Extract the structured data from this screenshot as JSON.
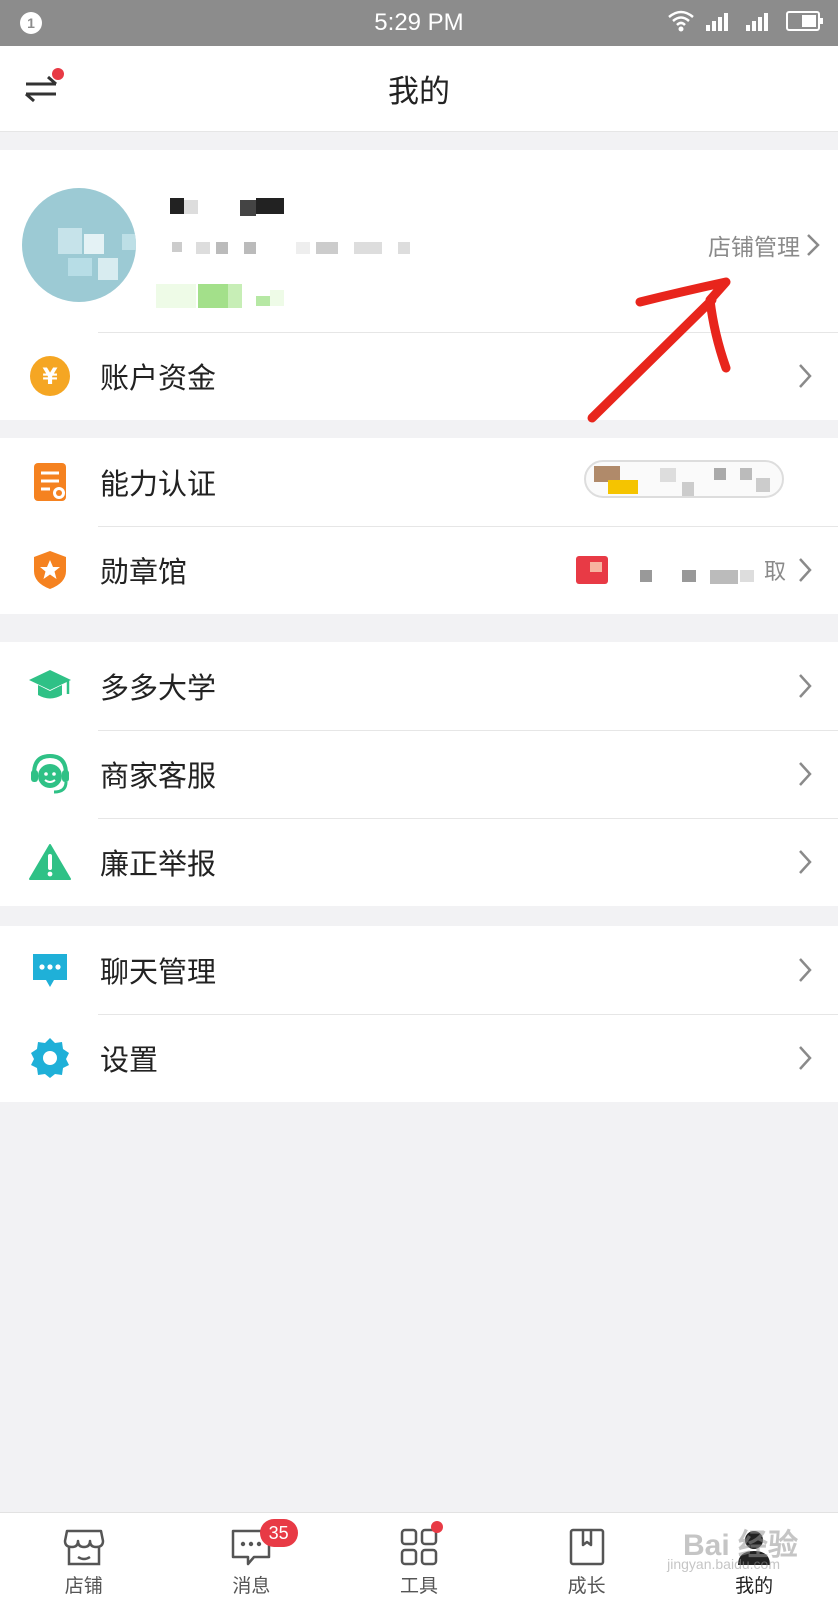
{
  "status_bar": {
    "notification_count": "1",
    "time": "5:29 PM"
  },
  "header": {
    "title": "我的"
  },
  "profile": {
    "store_manage_label": "店铺管理"
  },
  "sections": [
    {
      "rows": [
        {
          "label": "账户资金",
          "icon": "yuan-icon",
          "icon_color": "#f5a623"
        }
      ]
    },
    {
      "rows": [
        {
          "label": "能力认证",
          "icon": "certificate-icon",
          "icon_color": "#f58220"
        },
        {
          "label": "勋章馆",
          "icon": "badge-star-icon",
          "icon_color": "#f58220",
          "extra": "取"
        }
      ]
    },
    {
      "rows": [
        {
          "label": "多多大学",
          "icon": "graduation-cap-icon",
          "icon_color": "#2fc186"
        },
        {
          "label": "商家客服",
          "icon": "headset-icon",
          "icon_color": "#2fc186"
        },
        {
          "label": "廉正举报",
          "icon": "warning-icon",
          "icon_color": "#2fc186"
        }
      ]
    },
    {
      "rows": [
        {
          "label": "聊天管理",
          "icon": "chat-bubble-icon",
          "icon_color": "#1fb0d8"
        },
        {
          "label": "设置",
          "icon": "gear-icon",
          "icon_color": "#1fb0d8"
        }
      ]
    }
  ],
  "bottom_nav": [
    {
      "label": "店铺",
      "icon": "store-icon"
    },
    {
      "label": "消息",
      "icon": "message-icon",
      "badge": "35"
    },
    {
      "label": "工具",
      "icon": "grid-icon"
    },
    {
      "label": "成长",
      "icon": "bookmark-icon"
    },
    {
      "label": "我的",
      "icon": "person-icon",
      "active": true
    }
  ],
  "watermark": {
    "text": "Bai 经验",
    "sub": "jingyan.baidu.com"
  },
  "colors": {
    "accent_red": "#e83a45",
    "status_bar": "#8c8c8c",
    "background": "#f2f2f4"
  }
}
